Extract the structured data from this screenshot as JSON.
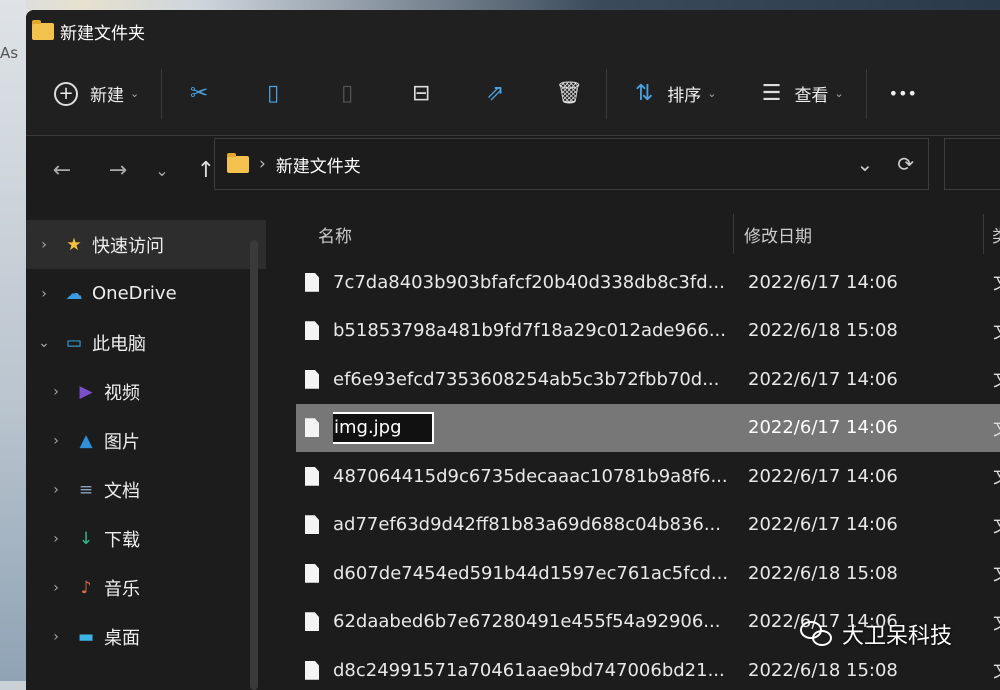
{
  "desktop": {
    "partial_text": "As"
  },
  "window": {
    "title": "新建文件夹"
  },
  "toolbar": {
    "new_label": "新建",
    "sort_label": "排序",
    "view_label": "查看",
    "more": "•••",
    "icons": [
      "cut-icon",
      "copy-icon",
      "paste-icon",
      "rename-icon",
      "share-icon",
      "delete-icon"
    ]
  },
  "nav": {
    "back": "←",
    "forward": "→",
    "recent": "⌄",
    "up": "↑",
    "breadcrumb_sep": "›",
    "path": "新建文件夹",
    "dropdown": "⌄",
    "refresh": "⟳"
  },
  "sidebar": {
    "items": [
      {
        "label": "快速访问",
        "icon": "★",
        "color": "#f5c242",
        "level": 0,
        "arrow": "›"
      },
      {
        "label": "OneDrive",
        "icon": "☁",
        "color": "#3b9ae1",
        "level": 0,
        "arrow": "›"
      },
      {
        "label": "此电脑",
        "icon": "▭",
        "color": "#3cb4e6",
        "level": 0,
        "arrow": "⌄"
      },
      {
        "label": "视频",
        "icon": "▶",
        "color": "#7b4fc9",
        "level": 1,
        "arrow": "›"
      },
      {
        "label": "图片",
        "icon": "▲",
        "color": "#2f8fd8",
        "level": 1,
        "arrow": "›"
      },
      {
        "label": "文档",
        "icon": "≡",
        "color": "#8aa2c0",
        "level": 1,
        "arrow": "›"
      },
      {
        "label": "下载",
        "icon": "↓",
        "color": "#2fbf8f",
        "level": 1,
        "arrow": "›"
      },
      {
        "label": "音乐",
        "icon": "♪",
        "color": "#e06a4a",
        "level": 1,
        "arrow": "›"
      },
      {
        "label": "桌面",
        "icon": "▬",
        "color": "#3cb4e6",
        "level": 1,
        "arrow": "›"
      }
    ]
  },
  "list": {
    "headers": {
      "name": "名称",
      "date": "修改日期",
      "type": "类"
    },
    "rows": [
      {
        "name": "7c7da8403b903bfafcf20b40d338db8c3fd...",
        "date": "2022/6/17 14:06",
        "type": "文"
      },
      {
        "name": "b51853798a481b9fd7f18a29c012ade966...",
        "date": "2022/6/18 15:08",
        "type": "文"
      },
      {
        "name": "ef6e93efcd7353608254ab5c3b72fbb70d...",
        "date": "2022/6/17 14:06",
        "type": "文"
      },
      {
        "name": "img.jpg",
        "date": "2022/6/17 14:06",
        "type": "文",
        "renaming": true
      },
      {
        "name": "487064415d9c6735decaaac10781b9a8f6...",
        "date": "2022/6/17 14:06",
        "type": "文"
      },
      {
        "name": "ad77ef63d9d42ff81b83a69d688c04b836...",
        "date": "2022/6/17 14:06",
        "type": "文"
      },
      {
        "name": "d607de7454ed591b44d1597ec761ac5fcd...",
        "date": "2022/6/18 15:08",
        "type": "文"
      },
      {
        "name": "62daabed6b7e67280491e455f54a92906...",
        "date": "2022/6/17 14:06",
        "type": "文"
      },
      {
        "name": "d8c24991571a70461aae9bd747006bd21...",
        "date": "2022/6/18 15:08",
        "type": "文"
      }
    ]
  },
  "watermark": {
    "text": "大卫呆科技"
  }
}
